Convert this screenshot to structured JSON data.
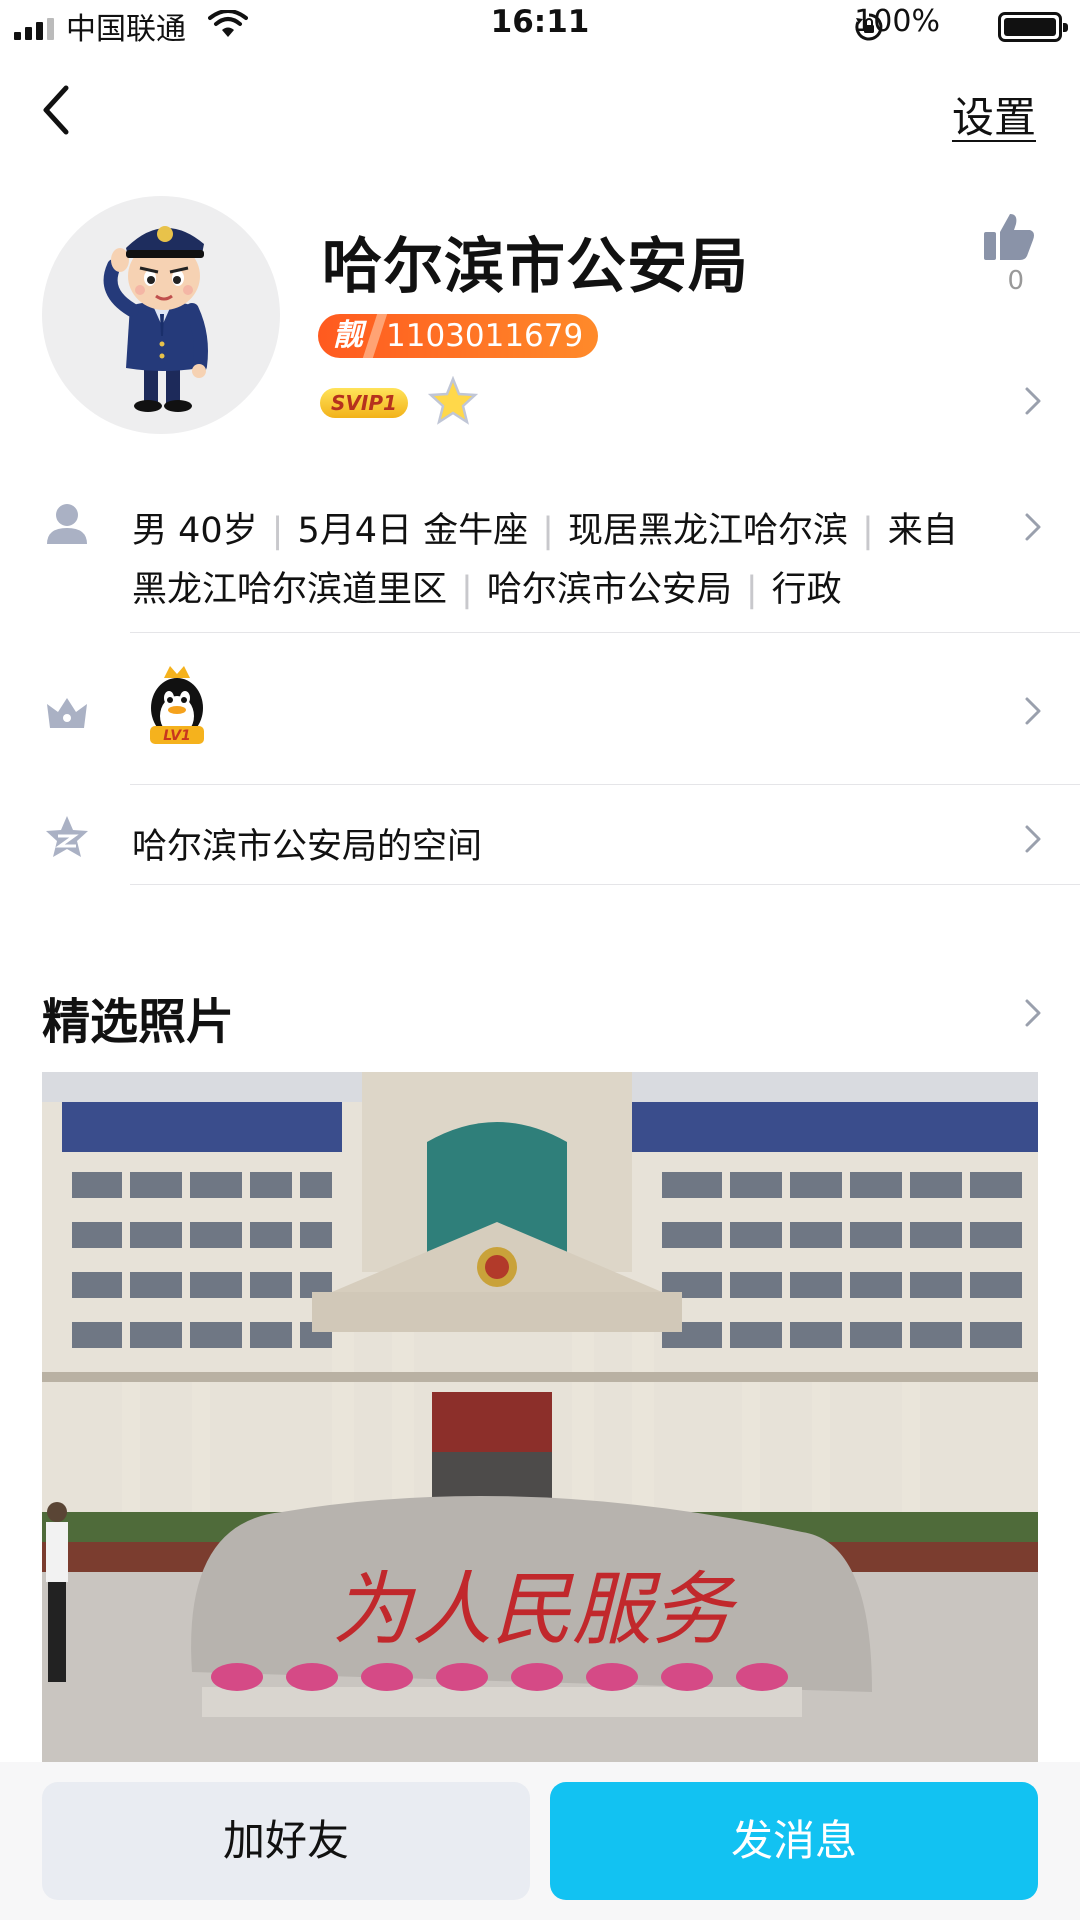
{
  "status_bar": {
    "carrier": "中国联通",
    "time": "16:11",
    "battery_percent": "100%"
  },
  "nav": {
    "settings_label": "设置"
  },
  "profile": {
    "name": "哈尔滨市公安局",
    "liang_badge": "靓",
    "qq_number": "1103011679",
    "svip_badge": "SVIP1",
    "like_count": "0"
  },
  "info": {
    "items": [
      "男 40岁",
      "5月4日 金牛座",
      "现居黑龙江哈尔滨",
      "来自黑龙江哈尔滨道里区",
      "哈尔滨市公安局",
      "行政"
    ]
  },
  "level": {
    "badge": "LV1"
  },
  "space": {
    "label": "哈尔滨市公安局的空间"
  },
  "photos": {
    "title": "精选照片",
    "stone_text": "为人民服务"
  },
  "actions": {
    "add_friend": "加好友",
    "send_message": "发消息"
  },
  "colors": {
    "primary": "#12c2f2",
    "qq_id_badge": "#ff6a22",
    "divider": "#e5e5e8"
  }
}
